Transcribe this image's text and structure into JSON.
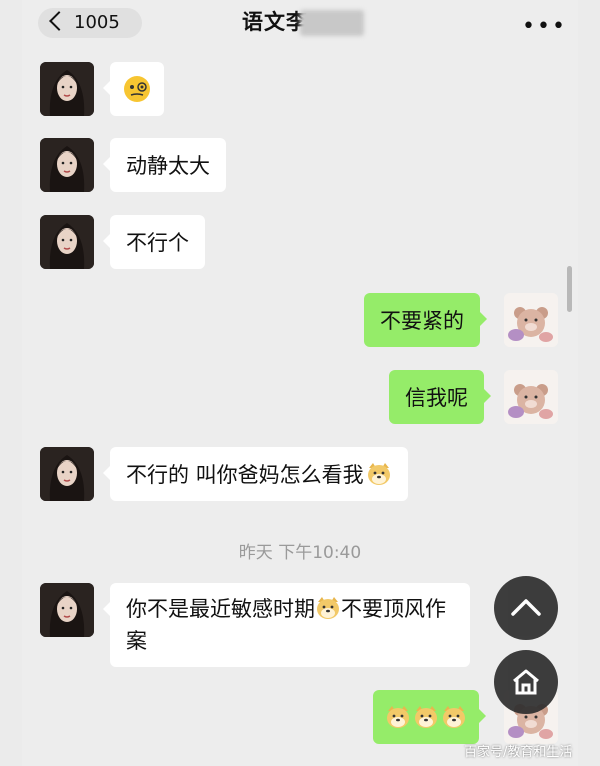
{
  "header": {
    "back_count": "1005",
    "title": "语文李",
    "more_icon": "more-dots-icon",
    "more_label": "•••"
  },
  "messages": [
    {
      "side": "left",
      "text": "",
      "emoji": "face-with-monocle-emoji"
    },
    {
      "side": "left",
      "text": "动静太大"
    },
    {
      "side": "left",
      "text": "不行个"
    },
    {
      "side": "right",
      "text": "不要紧的"
    },
    {
      "side": "right",
      "text": "信我呢"
    },
    {
      "side": "left",
      "text": "不行的 叫你爸妈怎么看我",
      "emoji": "doge-emoji"
    },
    {
      "side": "left",
      "text_a": "你不是最近敏感时期",
      "text_b": "不要顶风作案",
      "emoji": "doge-emoji"
    },
    {
      "side": "right",
      "text": "",
      "emoji": "doge-emoji x3"
    }
  ],
  "timestamp": "昨天 下午10:40",
  "buttons": {
    "scroll_up_icon": "chevron-up-icon",
    "home_icon": "home-icon"
  },
  "watermark": "百家号/教育和生活",
  "colors": {
    "background": "#ededed",
    "bubble_left": "#ffffff",
    "bubble_right": "#95ec69",
    "timestamp": "#9a9a9a"
  }
}
